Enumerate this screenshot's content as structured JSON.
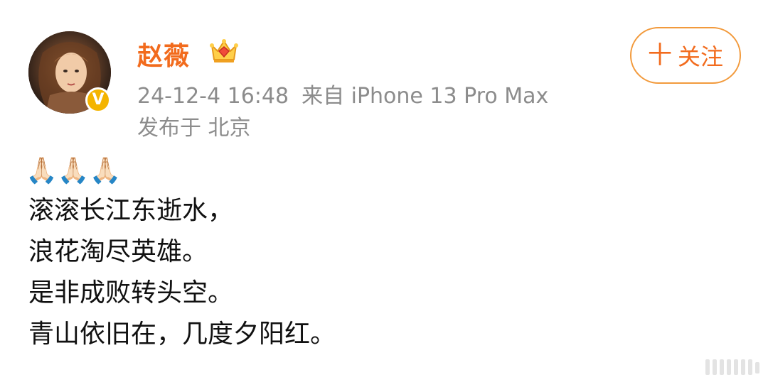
{
  "post": {
    "author": {
      "name": "赵薇",
      "verified_mark": "V",
      "crown_icon": "crown-icon"
    },
    "meta": {
      "timestamp": "24-12-4 16:48",
      "source": "来自 iPhone 13 Pro Max",
      "location": "发布于 北京"
    },
    "follow_button": {
      "plus": "十",
      "label": "关注"
    },
    "emoji_line": "🙏🏻🙏🏻🙏🏻",
    "lines": [
      "滚滚长江东逝水，",
      "浪花淘尽英雄。",
      "是非成败转头空。",
      "青山依旧在，几度夕阳红。"
    ]
  },
  "colors": {
    "accent": "#f26b1d",
    "meta_gray": "#8c8c8c",
    "verified": "#f4b400"
  }
}
